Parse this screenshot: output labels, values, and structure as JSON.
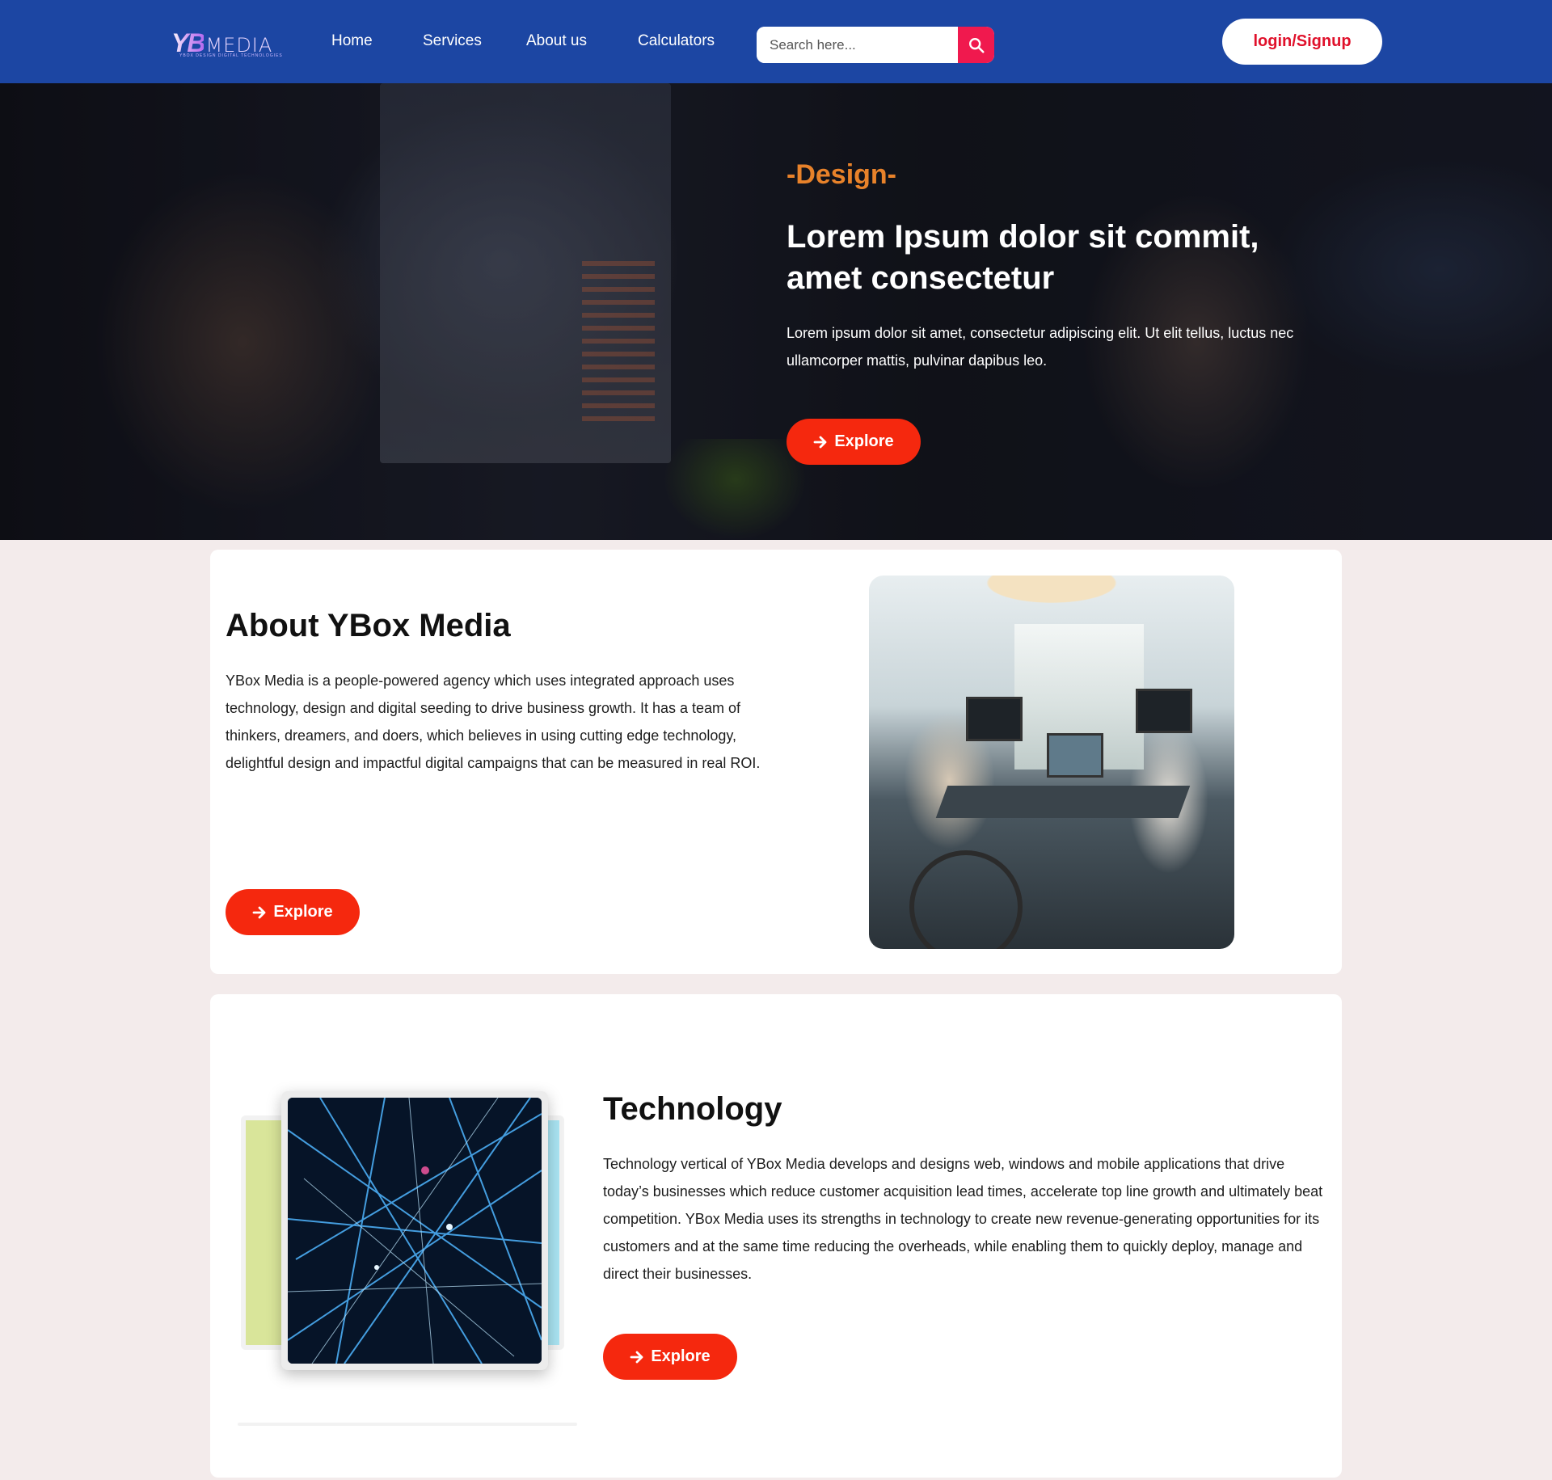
{
  "header": {
    "logo": {
      "mark": "YB",
      "word": "MEDIA",
      "tagline": "YBOX DESIGN DIGITAL TECHNOLOGIES"
    },
    "nav": [
      {
        "label": "Home"
      },
      {
        "label": "Services"
      },
      {
        "label": "About us"
      },
      {
        "label": "Calculators"
      }
    ],
    "search": {
      "placeholder": "Search here...",
      "value": "",
      "icon": "search-icon"
    },
    "login_label": "login/Signup"
  },
  "hero": {
    "kicker": "-Design-",
    "title": "Lorem Ipsum dolor sit commit, amet consectetur",
    "text": "Lorem ipsum dolor sit amet, consectetur adipiscing elit. Ut elit tellus, luctus nec ullamcorper mattis, pulvinar dapibus leo.",
    "button_label": "Explore"
  },
  "about": {
    "title": "About YBox Media",
    "text": "YBox Media is a people-powered agency which uses integrated approach uses technology, design and digital seeding to drive business growth. It has a team of thinkers, dreamers, and doers, which believes in using cutting edge technology, delightful design and impactful digital campaigns that can be measured in real ROI.",
    "button_label": "Explore"
  },
  "technology": {
    "title": "Technology",
    "text": "Technology vertical of YBox Media develops and designs web, windows and mobile applications that drive today’s businesses which reduce customer acquisition lead times, accelerate top line growth and ultimately beat competition. YBox Media uses its strengths in technology to create new revenue-generating opportunities for its customers and at the same time reducing the overheads, while enabling them to quickly deploy, manage and direct their businesses.",
    "button_label": "Explore"
  },
  "colors": {
    "header_bg": "#1c46a3",
    "accent_red": "#f5280e",
    "search_button": "#f0194e",
    "login_text": "#e0112b",
    "kicker": "#e8822a",
    "page_bg": "#f3ebeb"
  }
}
